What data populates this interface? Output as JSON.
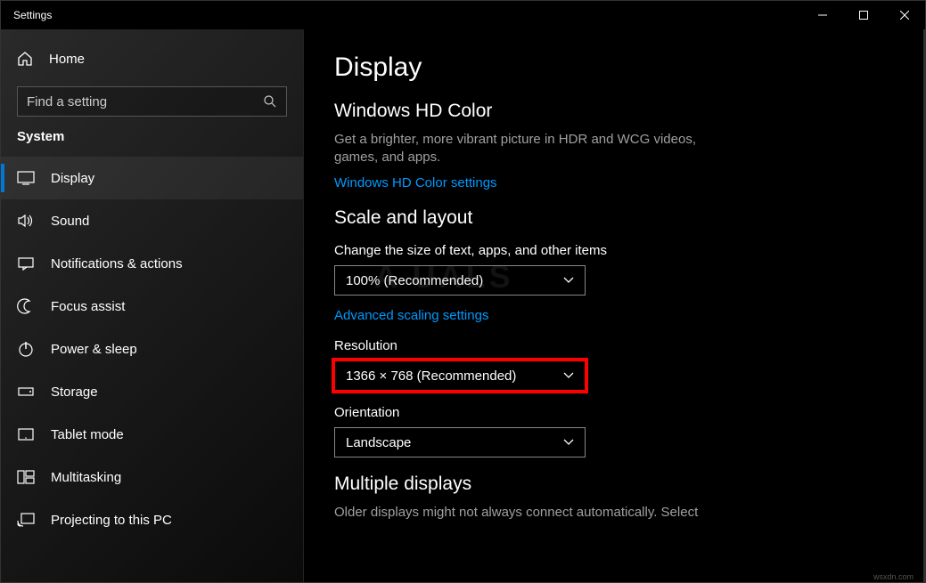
{
  "window": {
    "title": "Settings"
  },
  "search": {
    "placeholder": "Find a setting"
  },
  "category": "System",
  "home": "Home",
  "nav": {
    "display": "Display",
    "sound": "Sound",
    "notifications": "Notifications & actions",
    "focus": "Focus assist",
    "power": "Power & sleep",
    "storage": "Storage",
    "tablet": "Tablet mode",
    "multitask": "Multitasking",
    "projecting": "Projecting to this PC"
  },
  "page": {
    "title": "Display",
    "hd": {
      "heading": "Windows HD Color",
      "desc": "Get a brighter, more vibrant picture in HDR and WCG videos, games, and apps.",
      "link": "Windows HD Color settings"
    },
    "scale": {
      "heading": "Scale and layout",
      "sizeLabel": "Change the size of text, apps, and other items",
      "sizeValue": "100% (Recommended)",
      "advancedLink": "Advanced scaling settings",
      "resLabel": "Resolution",
      "resValue": "1366 × 768 (Recommended)",
      "orientLabel": "Orientation",
      "orientValue": "Landscape"
    },
    "multi": {
      "heading": "Multiple displays",
      "desc": "Older displays might not always connect automatically. Select"
    }
  },
  "watermark": "A   UALS",
  "attribution": "wsxdn.com"
}
